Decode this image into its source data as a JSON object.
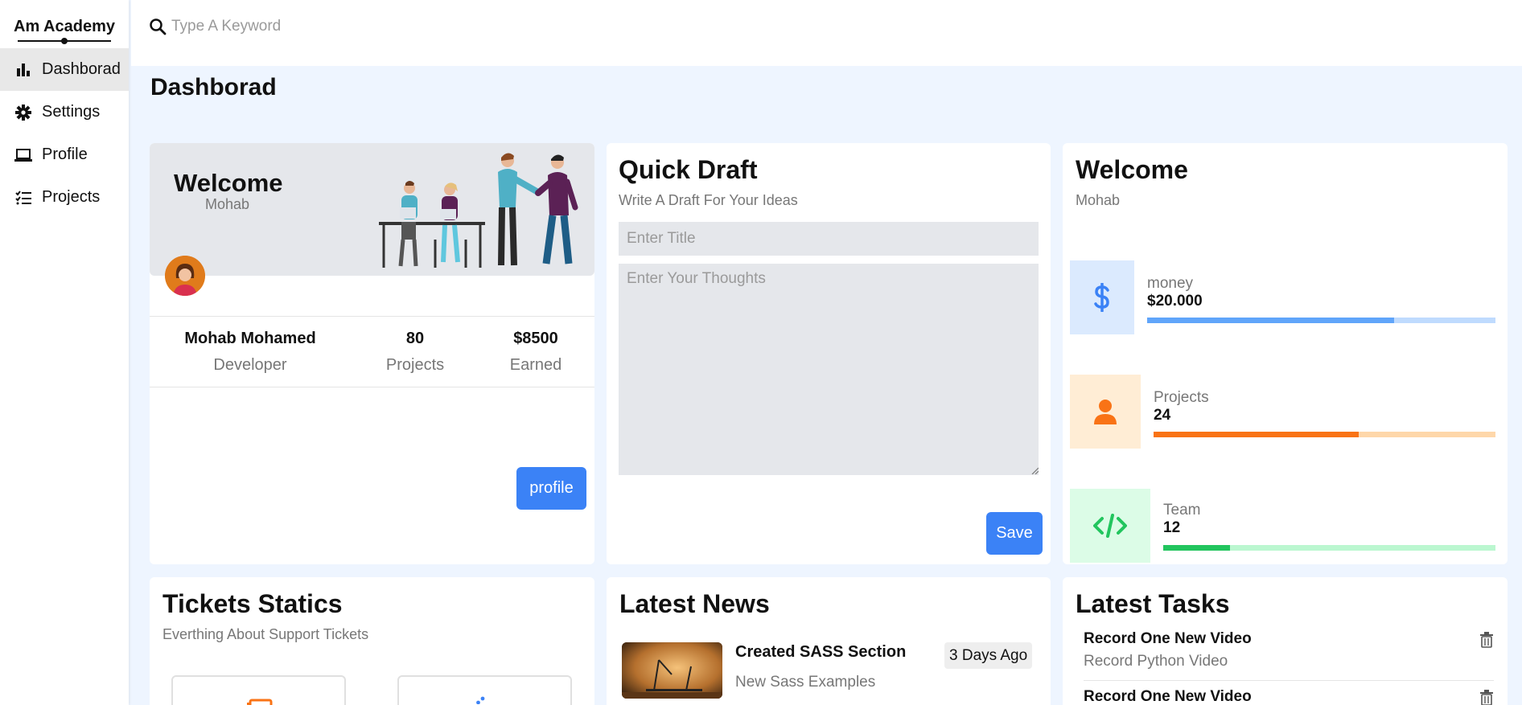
{
  "sidebar": {
    "logo": "Am Academy",
    "items": [
      {
        "label": "Dashborad",
        "icon": "chart-bar-icon",
        "active": true
      },
      {
        "label": "Settings",
        "icon": "gear-icon",
        "active": false
      },
      {
        "label": "Profile",
        "icon": "laptop-icon",
        "active": false
      },
      {
        "label": "Projects",
        "icon": "list-check-icon",
        "active": false
      }
    ]
  },
  "header": {
    "search_placeholder": "Type A Keyword"
  },
  "page": {
    "title": "Dashborad"
  },
  "welcome_card": {
    "title": "Welcome",
    "subtitle": "Mohab",
    "stats": [
      {
        "value": "Mohab Mohamed",
        "label": "Developer"
      },
      {
        "value": "80",
        "label": "Projects"
      },
      {
        "value": "$8500",
        "label": "Earned"
      }
    ],
    "button": "profile"
  },
  "quick_draft": {
    "title": "Quick Draft",
    "subtitle": "Write A Draft For Your Ideas",
    "title_placeholder": "Enter Title",
    "body_placeholder": "Enter Your Thoughts",
    "button": "Save"
  },
  "targets": {
    "title": "Welcome",
    "subtitle": "Mohab",
    "items": [
      {
        "label": "money",
        "value": "$20.000",
        "progress": 0.71,
        "icon": "dollar-icon",
        "color": "#3b82f6"
      },
      {
        "label": "Projects",
        "value": "24",
        "progress": 0.6,
        "icon": "user-icon",
        "color": "#f97316"
      },
      {
        "label": "Team",
        "value": "12",
        "progress": 0.2,
        "icon": "code-icon",
        "color": "#22c55e"
      }
    ]
  },
  "tickets": {
    "title": "Tickets Statics",
    "subtitle": "Everthing About Support Tickets"
  },
  "news": {
    "title": "Latest News",
    "items": [
      {
        "title": "Created SASS Section",
        "subtitle": "New Sass Examples",
        "date": "3 Days Ago"
      }
    ]
  },
  "tasks": {
    "title": "Latest Tasks",
    "items": [
      {
        "title": "Record One New Video",
        "subtitle": "Record Python Video"
      },
      {
        "title": "Record One New Video",
        "subtitle": ""
      }
    ]
  }
}
